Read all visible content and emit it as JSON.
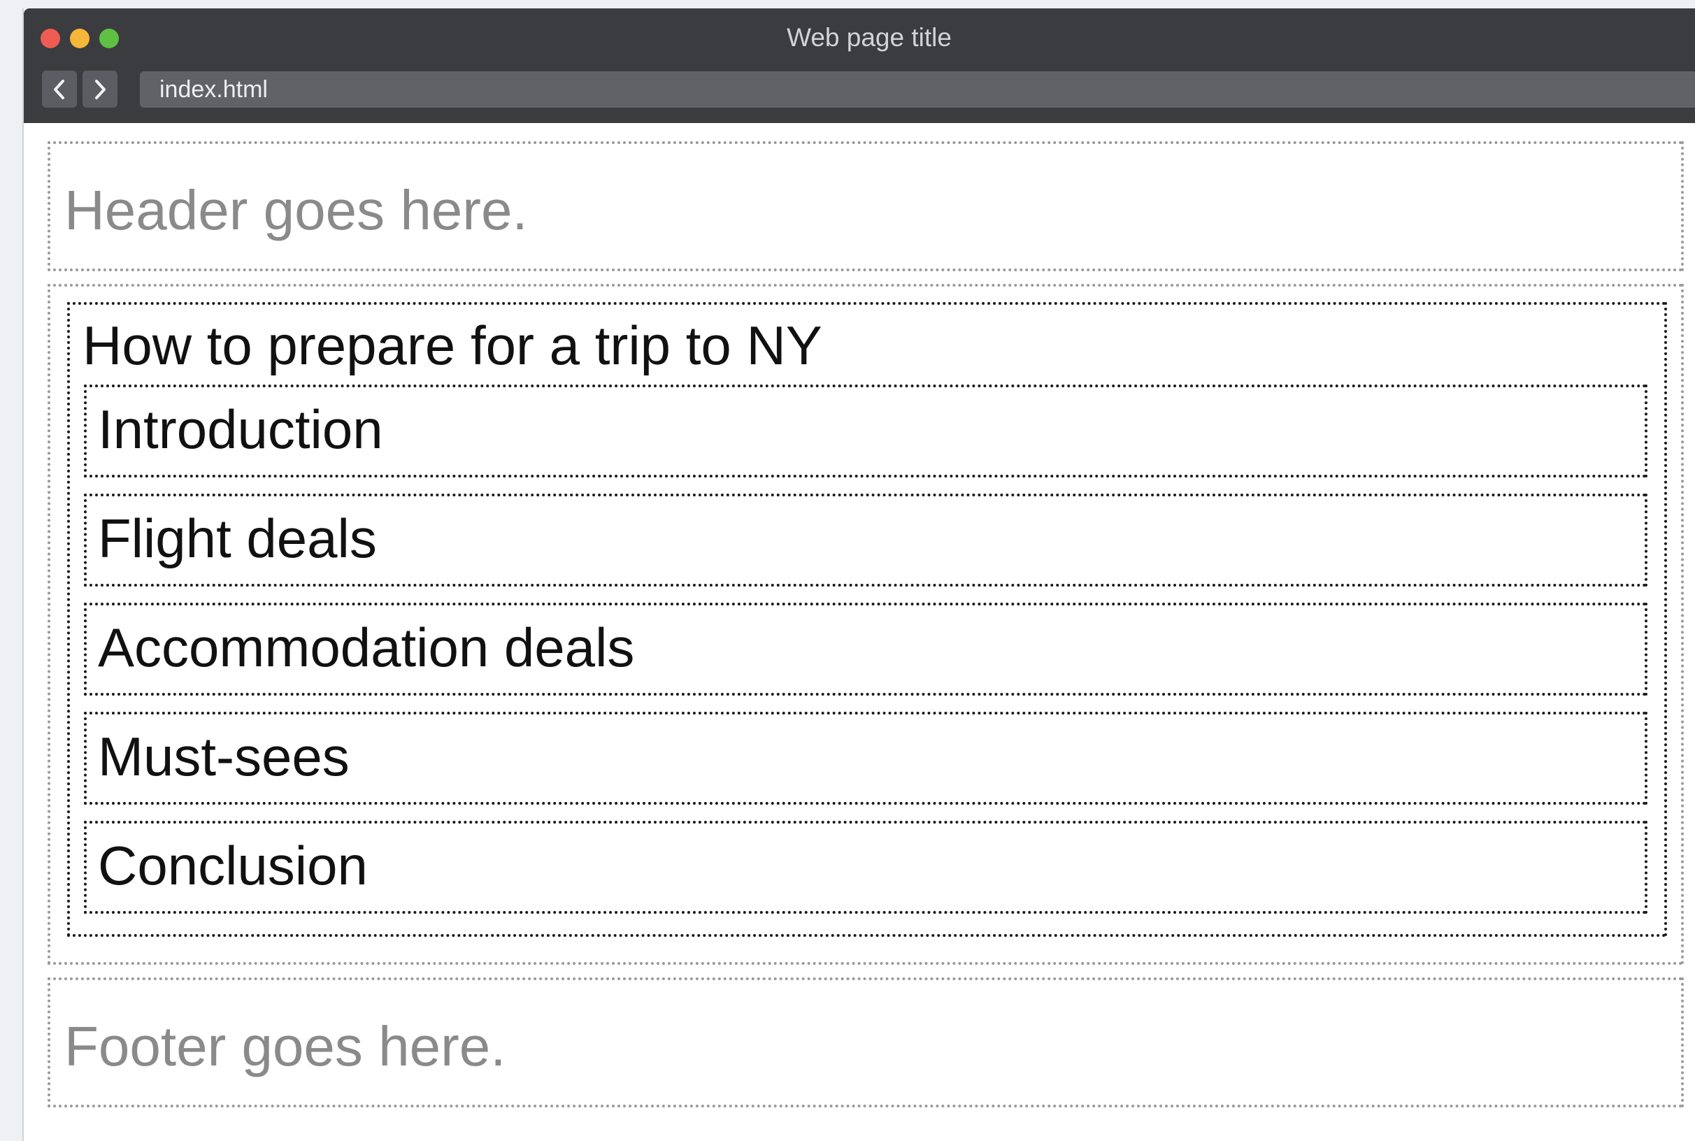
{
  "browser": {
    "title": "Web page title",
    "address": "index.html",
    "traffic_lights": {
      "close_color": "#ee5c53",
      "minimize_color": "#f5b63a",
      "maximize_color": "#5fc144"
    },
    "nav": {
      "back_icon": "chevron-left-icon",
      "forward_icon": "chevron-right-icon"
    }
  },
  "page": {
    "header_text": "Header goes here.",
    "footer_text": "Footer goes here.",
    "article": {
      "title": "How to prepare for a trip to NY",
      "sections": [
        {
          "label": "Introduction"
        },
        {
          "label": "Flight deals"
        },
        {
          "label": "Accommodation deals"
        },
        {
          "label": "Must-sees"
        },
        {
          "label": "Conclusion"
        }
      ]
    }
  },
  "colors": {
    "titlebar": "#3b3c40",
    "address_bar": "#616266",
    "placeholder_text": "#8a8a8a",
    "outer_border": "#9a9a9a",
    "inner_border": "#1a1a1a"
  }
}
